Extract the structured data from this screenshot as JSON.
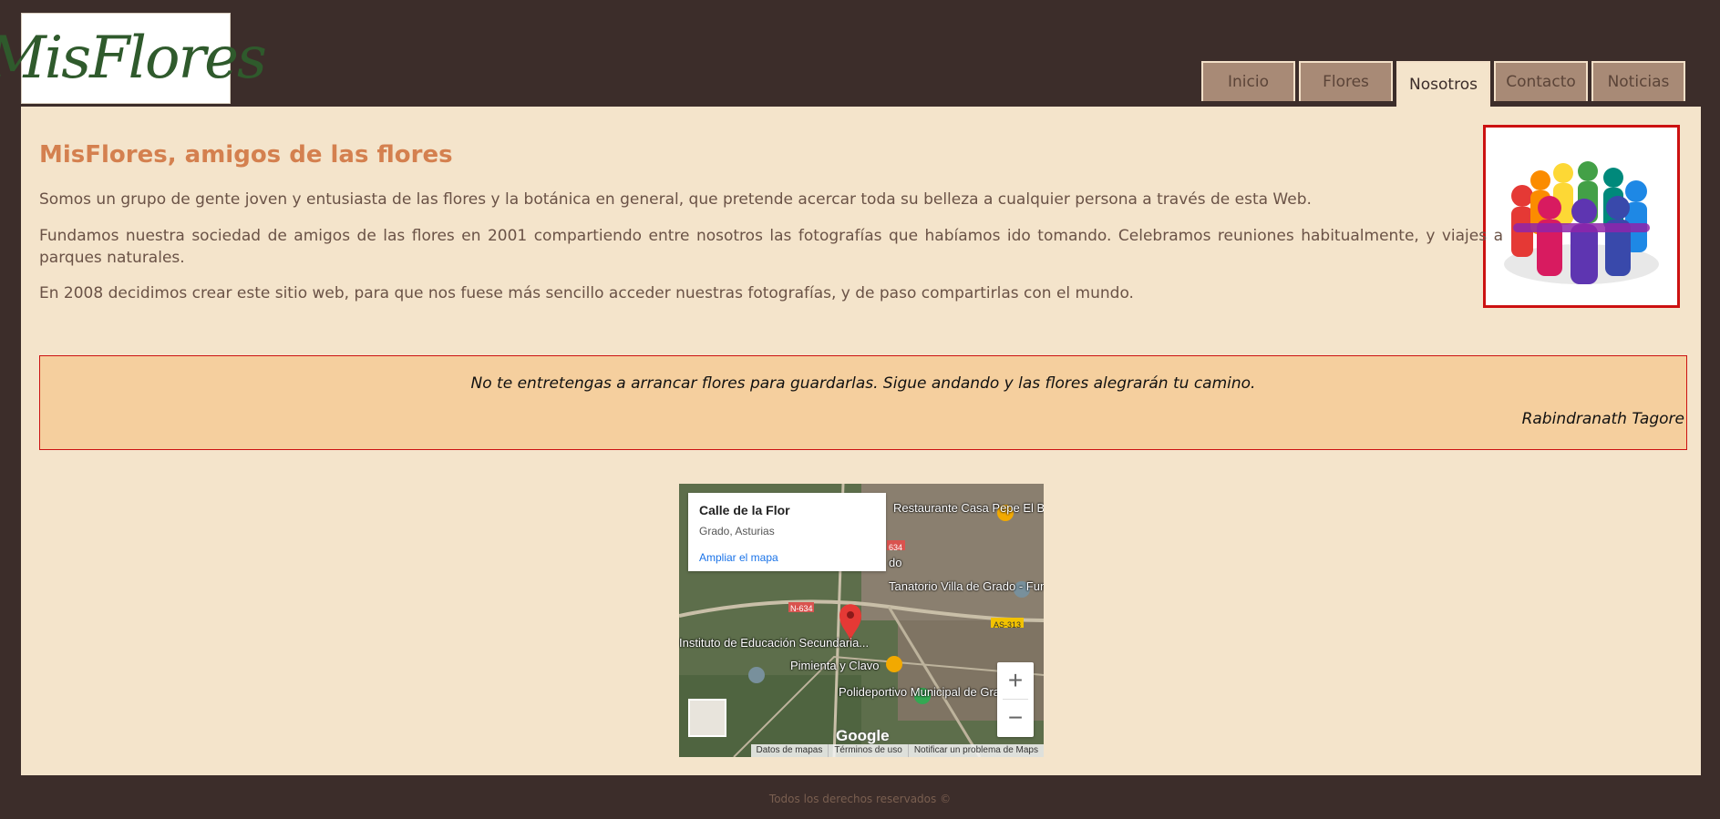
{
  "site": {
    "logo_text": "MisFlores"
  },
  "nav": {
    "tabs": [
      {
        "label": "Inicio"
      },
      {
        "label": "Flores"
      },
      {
        "label": "Nosotros",
        "active": true
      },
      {
        "label": "Contacto"
      },
      {
        "label": "Noticias"
      }
    ]
  },
  "content": {
    "title": "MisFlores, amigos de las flores",
    "paragraphs": [
      "Somos un grupo de gente joven y entusiasta de las flores y la botánica en general, que pretende acercar toda su belleza a cualquier persona a través de esta Web.",
      "Fundamos nuestra sociedad de amigos de las flores en 2001 compartiendo entre nosotros las fotografías que habíamos ido tomando. Celebramos reuniones habitualmente, y viajes a parques naturales.",
      "En 2008 decidimos crear este sitio web, para que nos fuese más sencillo acceder nuestras fotografías, y de paso compartirlas con el mundo."
    ],
    "team_image_icon": "team-circle-image"
  },
  "quote": {
    "text": "No te entretengas a arrancar flores para guardarlas. Sigue andando y las flores alegrarán tu camino.",
    "author": "Rabindranath Tagore"
  },
  "map": {
    "card_title": "Calle de la Flor",
    "card_subtitle": "Grado, Asturias",
    "card_link": "Ampliar el mapa",
    "labels": {
      "restaurant": "Restaurante Casa Pepe El Bueno",
      "funeral": "Tanatorio Villa de Grado - Funeraria San Pedro",
      "school": "Instituto de Educación Secundaria...",
      "pimienta": "Pimienta y Clavo",
      "sports": "Polideportivo Municipal de Grado",
      "town_partial": "do",
      "road_n634": "N-634",
      "road_as313": "AS-313",
      "road_634": "634"
    },
    "zoom_in": "+",
    "zoom_out": "−",
    "google": "Google",
    "attribution": [
      "Datos de mapas",
      "Términos de uso",
      "Notificar un problema de Maps"
    ]
  },
  "footer": {
    "text": "Todos los derechos reservados ©"
  },
  "colors": {
    "page_bg": "#3c2d2a",
    "content_bg": "#f4e4cb",
    "title": "#d4804f",
    "quote_bg": "#f5cf9e",
    "tab_bg": "#a88a76",
    "accent_border": "#cc1111"
  }
}
